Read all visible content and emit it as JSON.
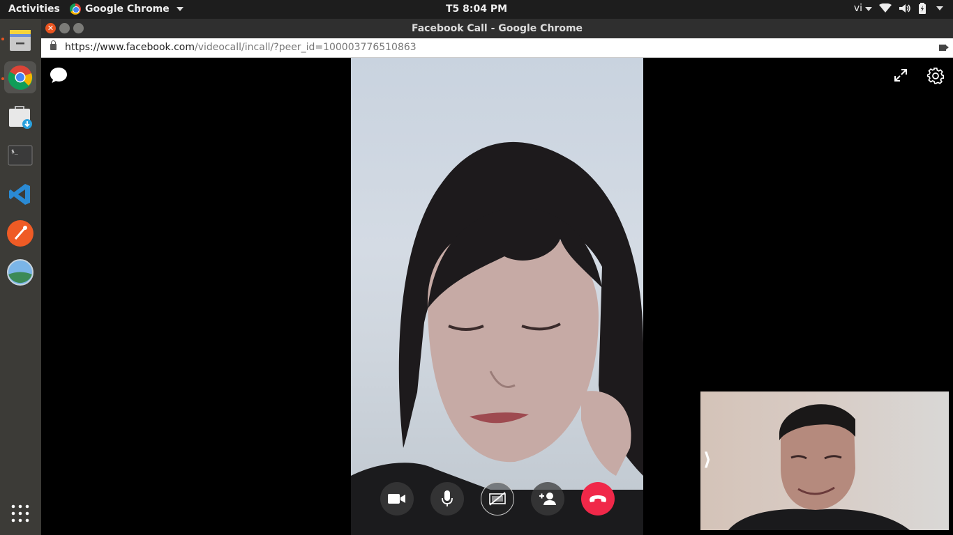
{
  "topbar": {
    "activities": "Activities",
    "app_name": "Google Chrome",
    "clock": "T5  8:04 PM",
    "input_method": "vi"
  },
  "window": {
    "title": "Facebook Call - Google Chrome",
    "url_host": "https://www.facebook.com",
    "url_path": "/videocall/incall/?peer_id=100003776510863"
  },
  "dock": {
    "items": [
      "files-icon",
      "chrome-icon",
      "software-center-icon",
      "terminal-icon",
      "vscode-icon",
      "postman-icon",
      "shotwell-icon",
      "show-apps-icon"
    ]
  },
  "call": {
    "controls": [
      "video-toggle",
      "mic-toggle",
      "screen-share",
      "add-person",
      "end-call"
    ],
    "end_color": "#f02849"
  },
  "self_view": {
    "toggle_glyph": "⟩"
  }
}
